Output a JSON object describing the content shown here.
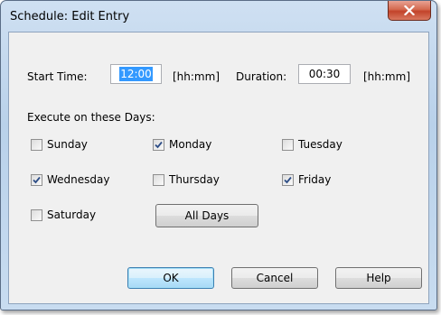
{
  "window": {
    "title": "Schedule: Edit Entry"
  },
  "time": {
    "start_label": "Start Time:",
    "start_value": "12:00",
    "start_unit": "[hh:mm]",
    "duration_label": "Duration:",
    "duration_value": "00:30",
    "duration_unit": "[hh:mm]"
  },
  "days": {
    "heading": "Execute on these Days:",
    "items": [
      {
        "label": "Sunday",
        "checked": false
      },
      {
        "label": "Monday",
        "checked": true
      },
      {
        "label": "Tuesday",
        "checked": false
      },
      {
        "label": "Wednesday",
        "checked": true
      },
      {
        "label": "Thursday",
        "checked": false
      },
      {
        "label": "Friday",
        "checked": true
      },
      {
        "label": "Saturday",
        "checked": false
      }
    ],
    "all_days_label": "All Days"
  },
  "buttons": {
    "ok": "OK",
    "cancel": "Cancel",
    "help": "Help"
  },
  "colors": {
    "selection": "#3399ff",
    "close": "#c2432a",
    "frame": "#b9d1ea"
  },
  "icons": {
    "close": "close-icon",
    "check": "checkmark-icon"
  }
}
